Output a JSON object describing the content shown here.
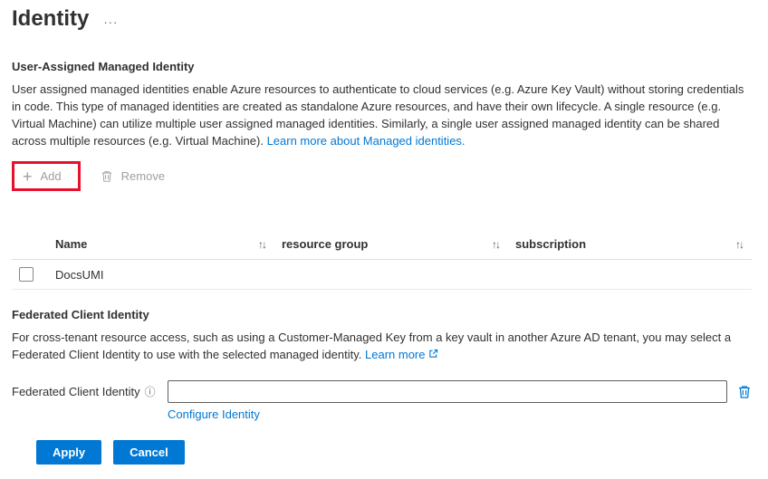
{
  "page": {
    "title": "Identity",
    "more_label": "···"
  },
  "icons": {
    "plus": "+",
    "sort": "↑↓",
    "info": "ⓘ"
  },
  "uami": {
    "heading": "User-Assigned Managed Identity",
    "description": "User assigned managed identities enable Azure resources to authenticate to cloud services (e.g. Azure Key Vault) without storing credentials in code. This type of managed identities are created as standalone Azure resources, and have their own lifecycle. A single resource (e.g. Virtual Machine) can utilize multiple user assigned managed identities. Similarly, a single user assigned managed identity can be shared across multiple resources (e.g. Virtual Machine).",
    "learn_more_link": "Learn more about Managed identities.",
    "toolbar": {
      "add": "Add",
      "remove": "Remove"
    },
    "table": {
      "columns": [
        "Name",
        "resource group",
        "subscription"
      ],
      "rows": [
        {
          "name": "DocsUMI",
          "resource_group": "",
          "subscription": ""
        }
      ]
    }
  },
  "fci": {
    "heading": "Federated Client Identity",
    "description": "For cross-tenant resource access, such as using a Customer-Managed Key from a key vault in another Azure AD tenant, you may select a Federated Client Identity to use with the selected managed identity.",
    "learn_more_link": "Learn more",
    "field_label": "Federated Client Identity",
    "input_value": "",
    "configure_link": "Configure Identity"
  },
  "footer": {
    "apply": "Apply",
    "cancel": "Cancel"
  },
  "colors": {
    "accent": "#0078d4",
    "annotation": "#e8112d",
    "disabled_text": "#a19f9d"
  }
}
